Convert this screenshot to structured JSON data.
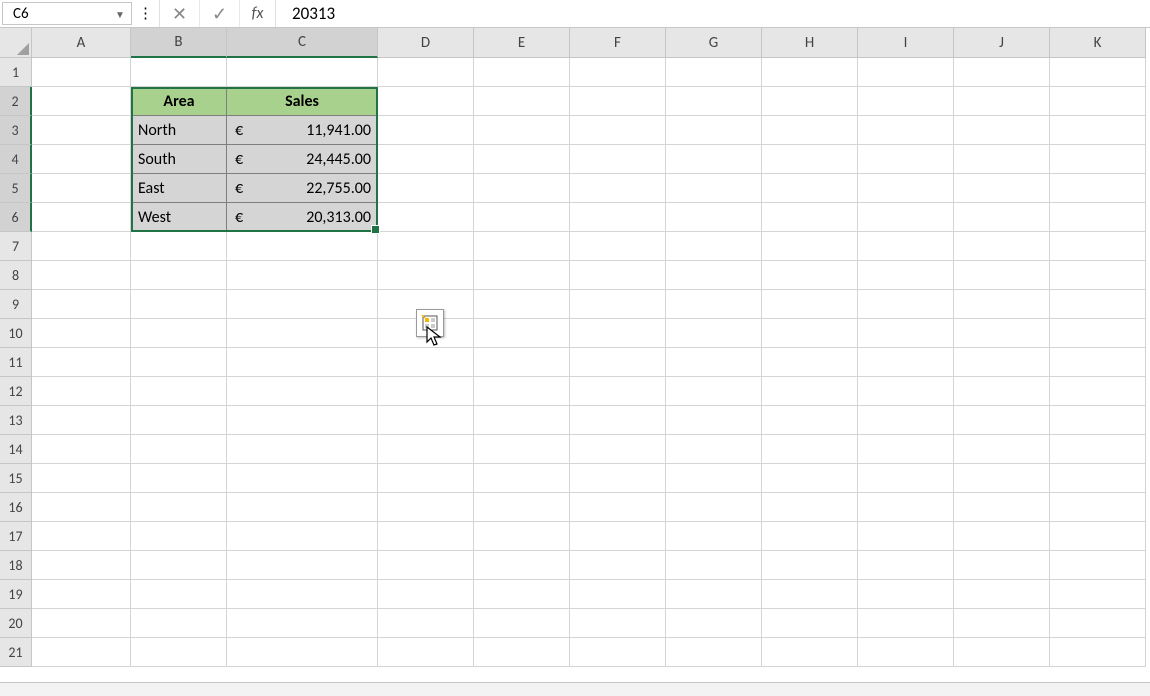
{
  "formula_bar": {
    "name_box": "C6",
    "cancel": "✕",
    "confirm": "✓",
    "fx": "fx",
    "formula_value": "20313"
  },
  "columns": [
    "A",
    "B",
    "C",
    "D",
    "E",
    "F",
    "G",
    "H",
    "I",
    "J",
    "K"
  ],
  "row_count": 21,
  "selected_cols": [
    "B",
    "C"
  ],
  "selected_rows": [
    2,
    3,
    4,
    5,
    6
  ],
  "table": {
    "headers": {
      "area": "Area",
      "sales": "Sales"
    },
    "currency": "€",
    "rows": [
      {
        "area": "North",
        "sales": "11,941.00"
      },
      {
        "area": "South",
        "sales": "24,445.00"
      },
      {
        "area": "East",
        "sales": "22,755.00"
      },
      {
        "area": "West",
        "sales": "20,313.00"
      }
    ]
  },
  "chart_data": {
    "type": "table",
    "title": "",
    "columns": [
      "Area",
      "Sales (€)"
    ],
    "rows": [
      [
        "North",
        11941.0
      ],
      [
        "South",
        24445.0
      ],
      [
        "East",
        22755.0
      ],
      [
        "West",
        20313.0
      ]
    ]
  }
}
